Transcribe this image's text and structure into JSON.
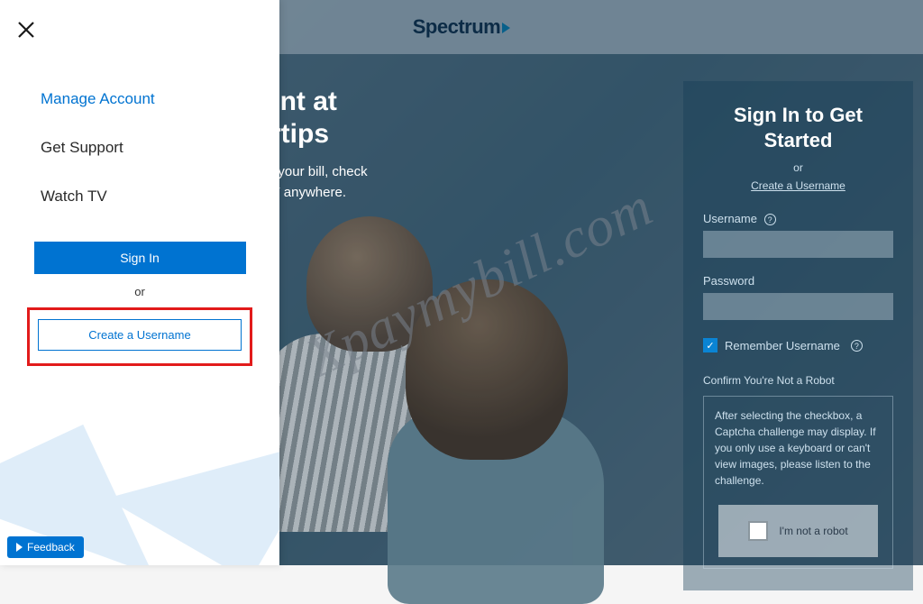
{
  "brand": "Spectrum",
  "hero": {
    "h_line1": "r Account at",
    "h_line2": "r Fingertips",
    "p_line1": "to view and pay your bill, check",
    "p_line2": "ail and watch TV anywhere."
  },
  "drawer": {
    "menu": [
      {
        "label": "Manage Account",
        "active": true
      },
      {
        "label": "Get Support",
        "active": false
      },
      {
        "label": "Watch TV",
        "active": false
      }
    ],
    "signin_btn": "Sign In",
    "or_label": "or",
    "create_btn": "Create a Username"
  },
  "signin": {
    "title_line1": "Sign In to Get",
    "title_line2": "Started",
    "or_label": "or",
    "create_link": "Create a Username",
    "username_label": "Username",
    "password_label": "Password",
    "remember_label": "Remember Username",
    "robot_title": "Confirm You're Not a Robot",
    "robot_text": "After selecting the checkbox, a Captcha challenge may display. If you only use a keyboard or can't view images, please listen to the challenge.",
    "captcha_label": "I'm not a robot"
  },
  "feedback_label": "Feedback",
  "watermark": "Xpaymybill.com"
}
